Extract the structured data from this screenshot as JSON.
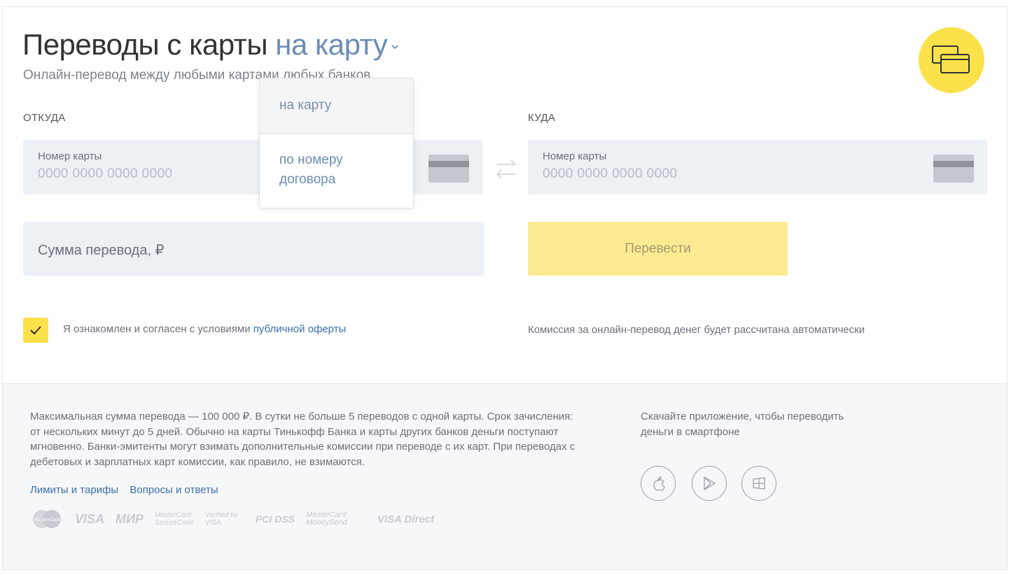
{
  "header": {
    "title_prefix": "Переводы с карты",
    "title_mode": "на карту",
    "subtitle": "Онлайн-перевод между любыми картами любых банков"
  },
  "from": {
    "section_label": "ОТКУДА",
    "card_label": "Номер карты",
    "card_placeholder": "0000 0000 0000 0000"
  },
  "to": {
    "section_label": "КУДА",
    "card_label": "Номер карты",
    "card_placeholder": "0000 0000 0000 0000"
  },
  "amount": {
    "placeholder": "Сумма перевода, ₽"
  },
  "submit": {
    "label": "Перевести"
  },
  "agreement": {
    "checked": true,
    "text": "Я ознакомлен и согласен с условиями ",
    "link": "публичной оферты"
  },
  "commission_note": "Комиссия за онлайн-перевод денег будет рассчитана автоматически",
  "dropdown": {
    "items": [
      {
        "label": "на карту",
        "selected": true
      },
      {
        "label": "по номеру\nдоговора",
        "selected": false
      }
    ]
  },
  "footer": {
    "info": "Максимальная сумма перевода — 100 000 ₽. В сутки не больше 5 переводов с одной карты. Срок зачисления: от нескольких минут до 5 дней. Обычно на карты Тинькофф Банка и карты других банков деньги поступают мгновенно. Банки-эмитенты могут взимать дополнительные комиссии при переводе с их карт. При переводах с дебетовых и зарплатных карт комиссии, как правило, не взимаются.",
    "links": [
      "Лимиты и тарифы",
      "Вопросы и ответы"
    ],
    "payment_logos": [
      "MasterCard",
      "VISA",
      "МИР",
      "MasterCard SecureCode",
      "Verified by VISA",
      "PCI DSS",
      "MasterCard MoneySend",
      "VISA Direct"
    ],
    "app_text": "Скачайте приложение, чтобы переводить деньги в смартфоне",
    "stores": [
      "apple-icon",
      "google-play-icon",
      "windows-icon"
    ]
  },
  "colors": {
    "accent_yellow": "#fbe14a",
    "button_yellow": "#faeb93",
    "field_bg": "#edf0f5",
    "link_blue": "#3a6fab"
  }
}
